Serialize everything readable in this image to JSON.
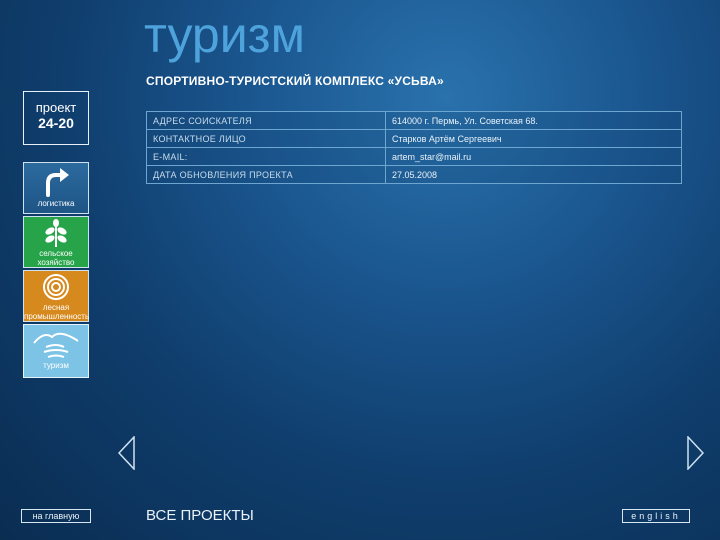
{
  "header": {
    "title": "туризм",
    "project_name": "СПОРТИВНО-ТУРИСТСКИЙ КОМПЛЕКС «УСЬВА»"
  },
  "badge": {
    "line1": "проект",
    "line2": "24-20"
  },
  "categories": [
    {
      "label": "логистика",
      "icon": "arrow-turn-icon",
      "color": "#1e5586"
    },
    {
      "label": "сельское хозяйство",
      "icon": "sprout-icon",
      "color": "#27a44a"
    },
    {
      "label": "лесная промышленность",
      "icon": "tree-rings-icon",
      "color": "#d6891c"
    },
    {
      "label": "туризм",
      "icon": "mountains-water-icon",
      "color": "#7cc3e6"
    }
  ],
  "info": [
    {
      "key": "АДРЕС СОИСКАТЕЛЯ",
      "value": "614000 г. Пермь, Ул. Советская 68."
    },
    {
      "key": "КОНТАКТНОЕ ЛИЦО",
      "value": "Старков Артём Сергеевич"
    },
    {
      "key": "E-MAIL:",
      "value": "artem_star@mail.ru"
    },
    {
      "key": "ДАТА ОБНОВЛЕНИЯ ПРОЕКТА",
      "value": "27.05.2008"
    }
  ],
  "footer": {
    "home": "на главную",
    "all_projects": "ВСЕ ПРОЕКТЫ",
    "english": "english"
  }
}
